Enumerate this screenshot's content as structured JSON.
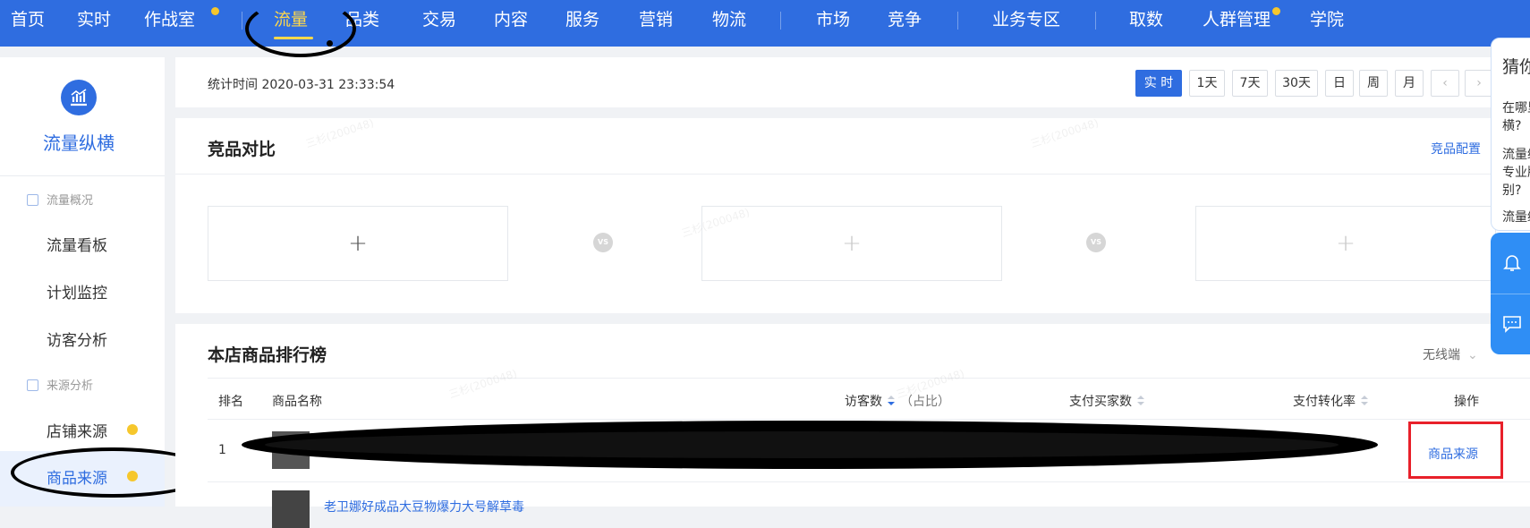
{
  "topnav": {
    "items": [
      {
        "label": "首页"
      },
      {
        "label": "实时"
      },
      {
        "label": "作战室"
      },
      {
        "label": "流量"
      },
      {
        "label": "品类"
      },
      {
        "label": "交易"
      },
      {
        "label": "内容"
      },
      {
        "label": "服务"
      },
      {
        "label": "营销"
      },
      {
        "label": "物流"
      },
      {
        "label": "市场"
      },
      {
        "label": "竞争"
      },
      {
        "label": "业务专区"
      },
      {
        "label": "取数"
      },
      {
        "label": "人群管理"
      },
      {
        "label": "学院"
      }
    ],
    "active": "流量",
    "accent_color": "#2f6de0",
    "active_color": "#ffd84a",
    "dot_color": "#f6c72c"
  },
  "sidebar": {
    "logo_icon": "bar-chart-icon",
    "title": "流量纵横",
    "groups": [
      {
        "label": "流量概况",
        "items": [
          {
            "label": "流量看板"
          },
          {
            "label": "计划监控"
          },
          {
            "label": "访客分析"
          }
        ]
      },
      {
        "label": "来源分析",
        "items": [
          {
            "label": "店铺来源"
          },
          {
            "label": "商品来源"
          }
        ]
      }
    ],
    "active_item": "商品来源"
  },
  "timebar": {
    "stat_time": "统计时间 2020-03-31 23:33:54",
    "buttons": [
      "实 时",
      "1天",
      "7天",
      "30天",
      "日",
      "周",
      "月"
    ],
    "active_button": "实 时"
  },
  "compare": {
    "title": "竞品对比",
    "config_link": "竞品配置",
    "vs_label": "VS",
    "plus": "+"
  },
  "ranking": {
    "title": "本店商品排行榜",
    "device": "无线端",
    "columns": {
      "rank": "排名",
      "name": "商品名称",
      "visitors": "访客数",
      "visitors_sub": "（占比）",
      "buyers": "支付买家数",
      "conversion": "支付转化率",
      "action": "操作"
    },
    "rows": [
      {
        "rank": "1",
        "action": "商品来源"
      },
      {
        "name": "老卫娜好成品大豆物爆力大号解草毒"
      }
    ]
  },
  "float_panel": {
    "heading": "猜你",
    "lines": [
      "在哪里",
      "横?",
      "流量纵",
      "专业版",
      "别?",
      "流量纵"
    ]
  },
  "watermark": "三杉(200048)"
}
